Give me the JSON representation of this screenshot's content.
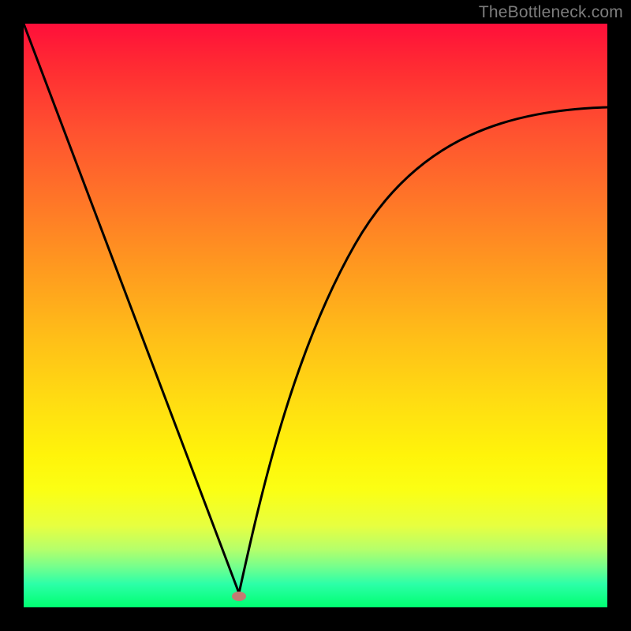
{
  "watermark": "TheBottleneck.com",
  "chart_data": {
    "type": "line",
    "title": "",
    "xlabel": "",
    "ylabel": "",
    "xlim": [
      0,
      100
    ],
    "ylim": [
      0,
      100
    ],
    "series": [
      {
        "name": "curve",
        "x": [
          0,
          5,
          10,
          15,
          20,
          25,
          30,
          34,
          36,
          37,
          38,
          40,
          44,
          48,
          52,
          56,
          60,
          65,
          70,
          75,
          80,
          85,
          90,
          95,
          100
        ],
        "values": [
          100,
          86,
          72,
          58,
          44,
          30,
          16,
          5,
          1,
          0,
          1,
          7,
          22,
          36,
          47,
          55,
          61,
          67,
          72,
          76,
          79,
          81,
          83,
          84.5,
          85.5
        ]
      }
    ],
    "marker": {
      "x": 37,
      "y": 0
    },
    "gradient_stops": [
      {
        "pos": 0,
        "color": "#ff0f3a"
      },
      {
        "pos": 100,
        "color": "#00ff71"
      }
    ]
  }
}
